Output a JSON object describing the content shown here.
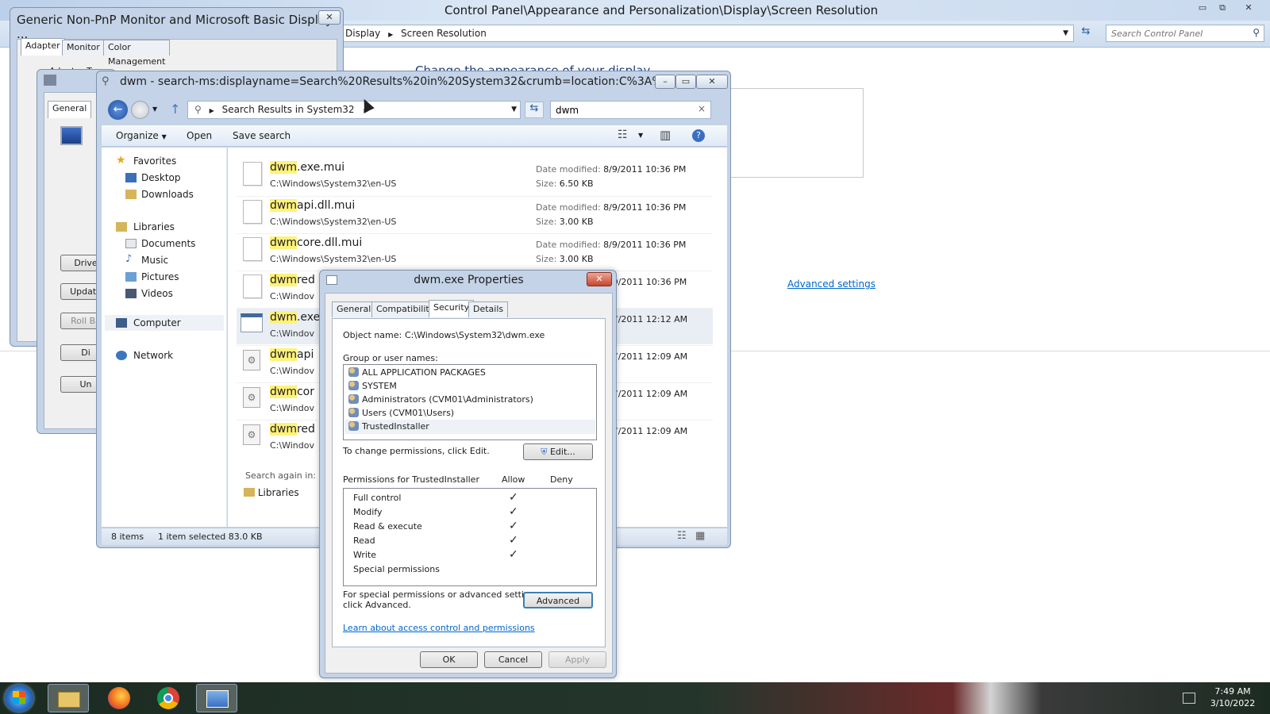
{
  "control_panel": {
    "title": "Control Panel\\Appearance and Personalization\\Display\\Screen Resolution",
    "breadcrumb": [
      "Display",
      "Screen Resolution"
    ],
    "search_placeholder": "Search Control Panel",
    "heading": "Change the appearance of your display",
    "advanced_link": "Advanced settings"
  },
  "monitor_dialog": {
    "title": "Generic Non-PnP Monitor and Microsoft Basic Display ...",
    "tabs": [
      "Adapter",
      "Monitor",
      "Color Management"
    ],
    "adapter_type_label": "Adapter Type",
    "inner_tab": "General",
    "buttons": [
      "Drive",
      "Update",
      "Roll Ba",
      "Di",
      "Un"
    ]
  },
  "explorer": {
    "title": "dwm - search-ms:displayname=Search%20Results%20in%20System32&crumb=location:C%3A%5C...",
    "address": "Search Results in System32",
    "search_value": "dwm",
    "toolbar": {
      "organize": "Organize",
      "open": "Open",
      "save_search": "Save search"
    },
    "nav": {
      "favorites": "Favorites",
      "desktop": "Desktop",
      "downloads": "Downloads",
      "libraries": "Libraries",
      "documents": "Documents",
      "music": "Music",
      "pictures": "Pictures",
      "videos": "Videos",
      "computer": "Computer",
      "network": "Network"
    },
    "files": [
      {
        "hl": "dwm",
        "rest": ".exe.mui",
        "path": "C:\\Windows\\System32\\en-US",
        "date_label": "Date modified:",
        "date": "8/9/2011 10:36 PM",
        "size_label": "Size:",
        "size": "6.50 KB"
      },
      {
        "hl": "dwm",
        "rest": "api.dll.mui",
        "path": "C:\\Windows\\System32\\en-US",
        "date_label": "Date modified:",
        "date": "8/9/2011 10:36 PM",
        "size_label": "Size:",
        "size": "3.00 KB"
      },
      {
        "hl": "dwm",
        "rest": "core.dll.mui",
        "path": "C:\\Windows\\System32\\en-US",
        "date_label": "Date modified:",
        "date": "8/9/2011 10:36 PM",
        "size_label": "Size:",
        "size": "3.00 KB"
      },
      {
        "hl": "dwm",
        "rest": "red",
        "path": "C:\\Windov",
        "date": "/9/2011 10:36 PM"
      },
      {
        "hl": "dwm",
        "rest": ".exe",
        "path": "C:\\Windov",
        "date": "/7/2011 12:12 AM"
      },
      {
        "hl": "dwm",
        "rest": "api",
        "path": "C:\\Windov",
        "date": "/7/2011 12:09 AM"
      },
      {
        "hl": "dwm",
        "rest": "cor",
        "path": "C:\\Windov",
        "date": "/7/2011 12:09 AM"
      },
      {
        "hl": "dwm",
        "rest": "red",
        "path": "C:\\Windov",
        "date": "/7/2011 12:09 AM"
      }
    ],
    "search_again": "Search again in:",
    "search_again_libraries": "Libraries",
    "status": {
      "count": "8 items",
      "selected": "1 item selected  83.0 KB"
    }
  },
  "properties": {
    "title": "dwm.exe Properties",
    "tabs": [
      "General",
      "Compatibility",
      "Security",
      "Details"
    ],
    "object_label": "Object name:",
    "object_value": "C:\\Windows\\System32\\dwm.exe",
    "group_label": "Group or user names:",
    "groups": [
      "ALL APPLICATION PACKAGES",
      "SYSTEM",
      "Administrators (CVM01\\Administrators)",
      "Users (CVM01\\Users)",
      "TrustedInstaller"
    ],
    "change_text": "To change permissions, click Edit.",
    "edit_button": "Edit...",
    "perm_header": "Permissions for TrustedInstaller",
    "allow": "Allow",
    "deny": "Deny",
    "permissions": [
      {
        "name": "Full control",
        "allow": "✓"
      },
      {
        "name": "Modify",
        "allow": "✓"
      },
      {
        "name": "Read & execute",
        "allow": "✓"
      },
      {
        "name": "Read",
        "allow": "✓"
      },
      {
        "name": "Write",
        "allow": "✓"
      },
      {
        "name": "Special permissions",
        "allow": ""
      }
    ],
    "special_text_1": "For special permissions or advanced settings,",
    "special_text_2": "click Advanced.",
    "advanced_button": "Advanced",
    "learn_link": "Learn about access control and permissions",
    "ok": "OK",
    "cancel": "Cancel",
    "apply": "Apply"
  },
  "taskbar": {
    "time": "7:49 AM",
    "date": "3/10/2022"
  },
  "colors": {
    "highlight": "#fff27a",
    "link": "#0066cc",
    "taskbar": "#1c2b22"
  }
}
